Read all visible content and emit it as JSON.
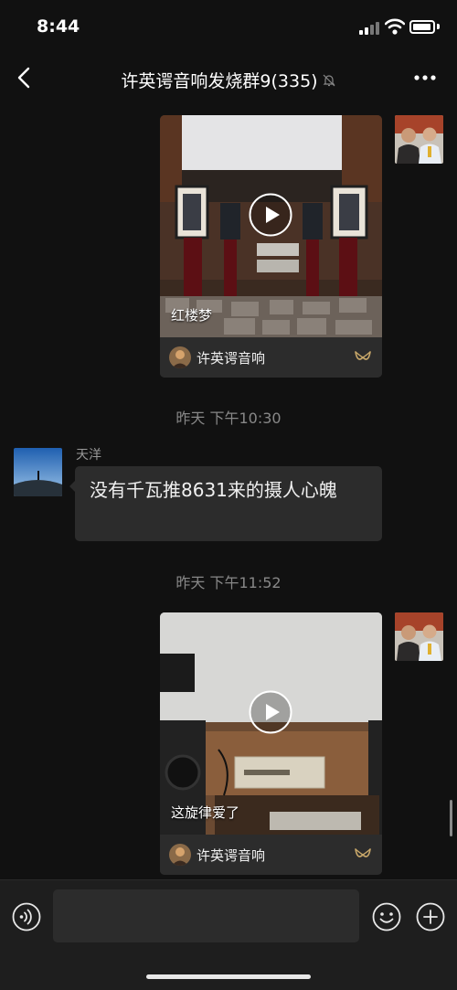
{
  "status_bar": {
    "time": "8:44"
  },
  "header": {
    "title": "许英谔音响发烧群9(335)"
  },
  "messages": [
    {
      "type": "video",
      "side": "right",
      "caption": "红楼梦",
      "source_name": "许英谔音响"
    },
    {
      "type": "timestamp",
      "text": "昨天 下午10:30"
    },
    {
      "type": "text",
      "side": "left",
      "sender": "天洋",
      "text": "没有千瓦推8631来的摄人心魄"
    },
    {
      "type": "timestamp",
      "text": "昨天 下午11:52"
    },
    {
      "type": "video",
      "side": "right",
      "caption": "这旋律爱了",
      "source_name": "许英谔音响"
    }
  ],
  "input_bar": {
    "placeholder": ""
  },
  "icons": {
    "back": "chevron-left-icon",
    "mute": "bell-off-icon",
    "more": "more-dots-icon",
    "play": "play-icon",
    "channel": "video-channel-icon",
    "voice": "voice-icon",
    "emoji": "emoji-icon",
    "add": "plus-icon"
  },
  "colors": {
    "background": "#111111",
    "bubble": "#2c2c2c",
    "accent": "#c9a86a",
    "timestamp": "#888888"
  }
}
